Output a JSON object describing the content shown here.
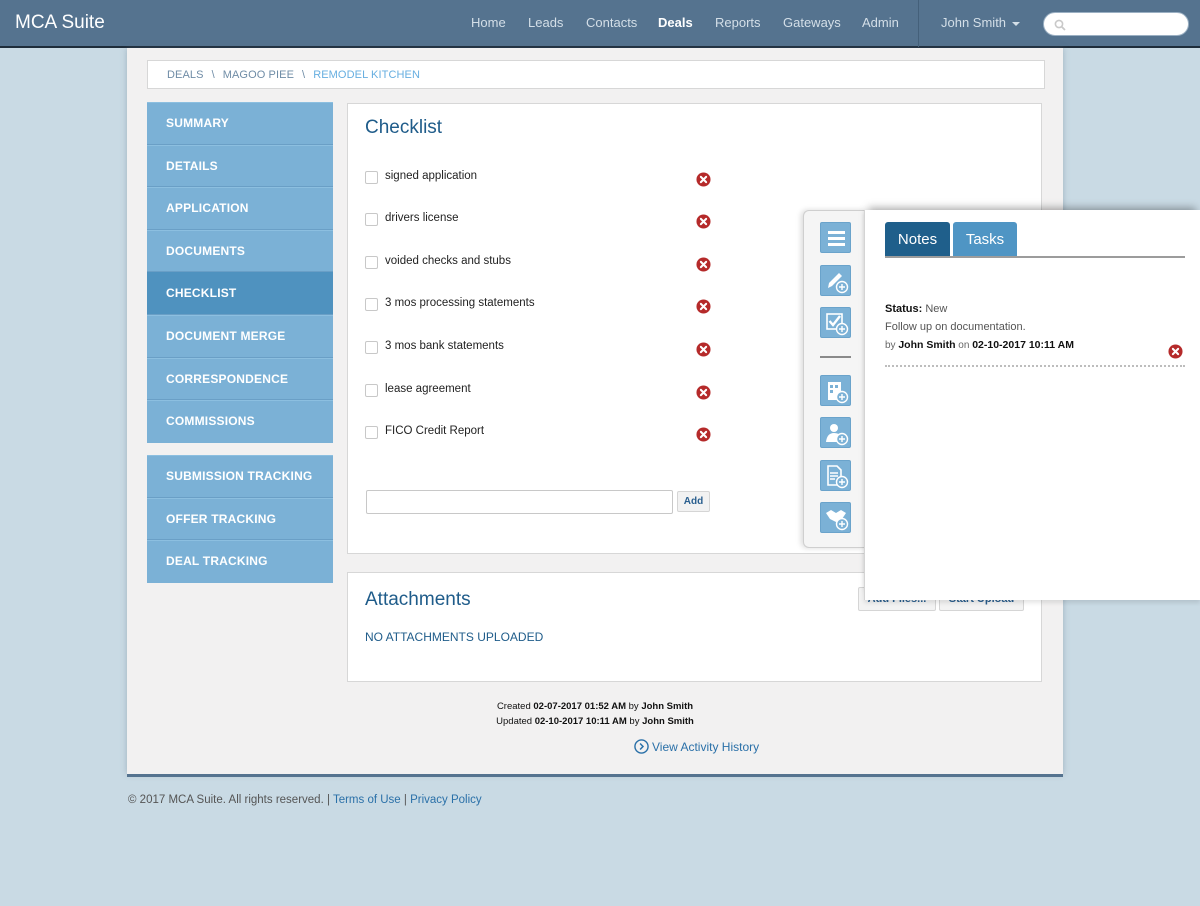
{
  "app": {
    "title": "MCA Suite"
  },
  "nav": {
    "links": [
      {
        "label": "Home",
        "active": false
      },
      {
        "label": "Leads",
        "active": false
      },
      {
        "label": "Contacts",
        "active": false
      },
      {
        "label": "Deals",
        "active": true
      },
      {
        "label": "Reports",
        "active": false
      },
      {
        "label": "Gateways",
        "active": false
      },
      {
        "label": "Admin",
        "active": false
      }
    ],
    "user": "John Smith",
    "search": {
      "placeholder": "",
      "value": "",
      "icon": "search-icon"
    }
  },
  "breadcrumb": {
    "items": [
      "DEALS",
      "MAGOO PIEE",
      "REMODEL KITCHEN"
    ],
    "separator": "\\"
  },
  "sidebar": {
    "group1": [
      {
        "label": "SUMMARY",
        "active": false
      },
      {
        "label": "DETAILS",
        "active": false
      },
      {
        "label": "APPLICATION",
        "active": false
      },
      {
        "label": "DOCUMENTS",
        "active": false
      },
      {
        "label": "CHECKLIST",
        "active": true
      },
      {
        "label": "DOCUMENT MERGE",
        "active": false
      },
      {
        "label": "CORRESPONDENCE",
        "active": false
      },
      {
        "label": "COMMISSIONS",
        "active": false
      }
    ],
    "group2": [
      {
        "label": "SUBMISSION TRACKING",
        "active": false
      },
      {
        "label": "OFFER TRACKING",
        "active": false
      },
      {
        "label": "DEAL TRACKING",
        "active": false
      }
    ]
  },
  "checklist": {
    "title": "Checklist",
    "items": [
      {
        "label": "signed application",
        "checked": false
      },
      {
        "label": "drivers license",
        "checked": false
      },
      {
        "label": "voided checks and stubs",
        "checked": false
      },
      {
        "label": "3 mos processing statements",
        "checked": false
      },
      {
        "label": "3 mos bank statements",
        "checked": false
      },
      {
        "label": "lease agreement",
        "checked": false
      },
      {
        "label": "FICO Credit Report",
        "checked": false
      }
    ],
    "new_item": {
      "value": "",
      "placeholder": ""
    },
    "add_label": "Add"
  },
  "attachments": {
    "title": "Attachments",
    "empty_text": "NO ATTACHMENTS UPLOADED",
    "add_files_label": "Add Files...",
    "start_upload_label": "Start Upload"
  },
  "meta": {
    "created_prefix": "Created",
    "created_at": "02-07-2017 01:52 AM",
    "created_by": "John Smith",
    "updated_prefix": "Updated",
    "updated_at": "02-10-2017 10:11 AM",
    "updated_by": "John Smith",
    "by_word": "by",
    "activity_link": "View Activity History"
  },
  "footer": {
    "copyright": "© 2017 MCA Suite. All rights reserved.",
    "links": [
      "Terms of Use",
      "Privacy Policy"
    ]
  },
  "drawer": {
    "rail_buttons": [
      "menu-icon",
      "add-note-icon",
      "add-task-icon",
      "add-business-icon",
      "add-contact-icon",
      "add-document-icon",
      "add-deal-icon"
    ],
    "tabs": [
      {
        "label": "Notes",
        "active": true
      },
      {
        "label": "Tasks",
        "active": false
      }
    ],
    "notes": [
      {
        "status_label": "Status:",
        "status": "New",
        "text": "Follow up on documentation.",
        "by_word": "by",
        "author": "John Smith",
        "on_word": "on",
        "timestamp": "02-10-2017 10:11 AM"
      }
    ]
  },
  "colors": {
    "navbar": "#55738f",
    "sidebar": "#7bb1d6",
    "sidebar_active": "#4f92bf",
    "heading": "#1f5c8a",
    "remove": "#b52a2a",
    "notes_tab": "#1f5f8b",
    "tasks_tab": "#4f95c4"
  }
}
